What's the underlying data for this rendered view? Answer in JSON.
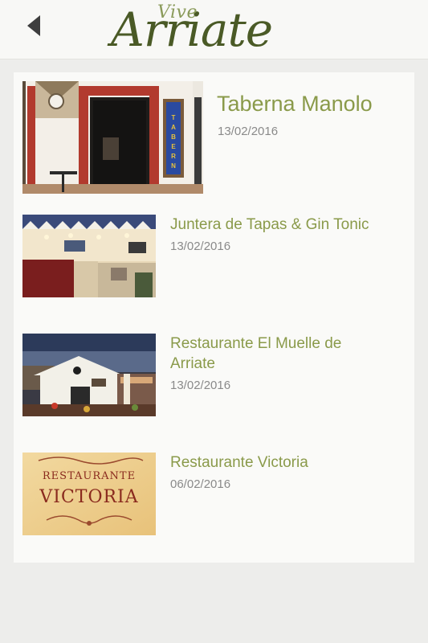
{
  "header": {
    "logo_small": "Vive",
    "logo_big": "Arriate"
  },
  "items": [
    {
      "title": "Taberna Manolo",
      "date": "13/02/2016",
      "sign_text": "TABERNA"
    },
    {
      "title": "Juntera de Tapas & Gin Tonic",
      "date": "13/02/2016"
    },
    {
      "title": "Restaurante El Muelle de Arriate",
      "date": "13/02/2016"
    },
    {
      "title": "Restaurante Victoria",
      "date": "06/02/2016",
      "sign_line1": "RESTAURANTE",
      "sign_line2": "VICTORIA"
    }
  ]
}
